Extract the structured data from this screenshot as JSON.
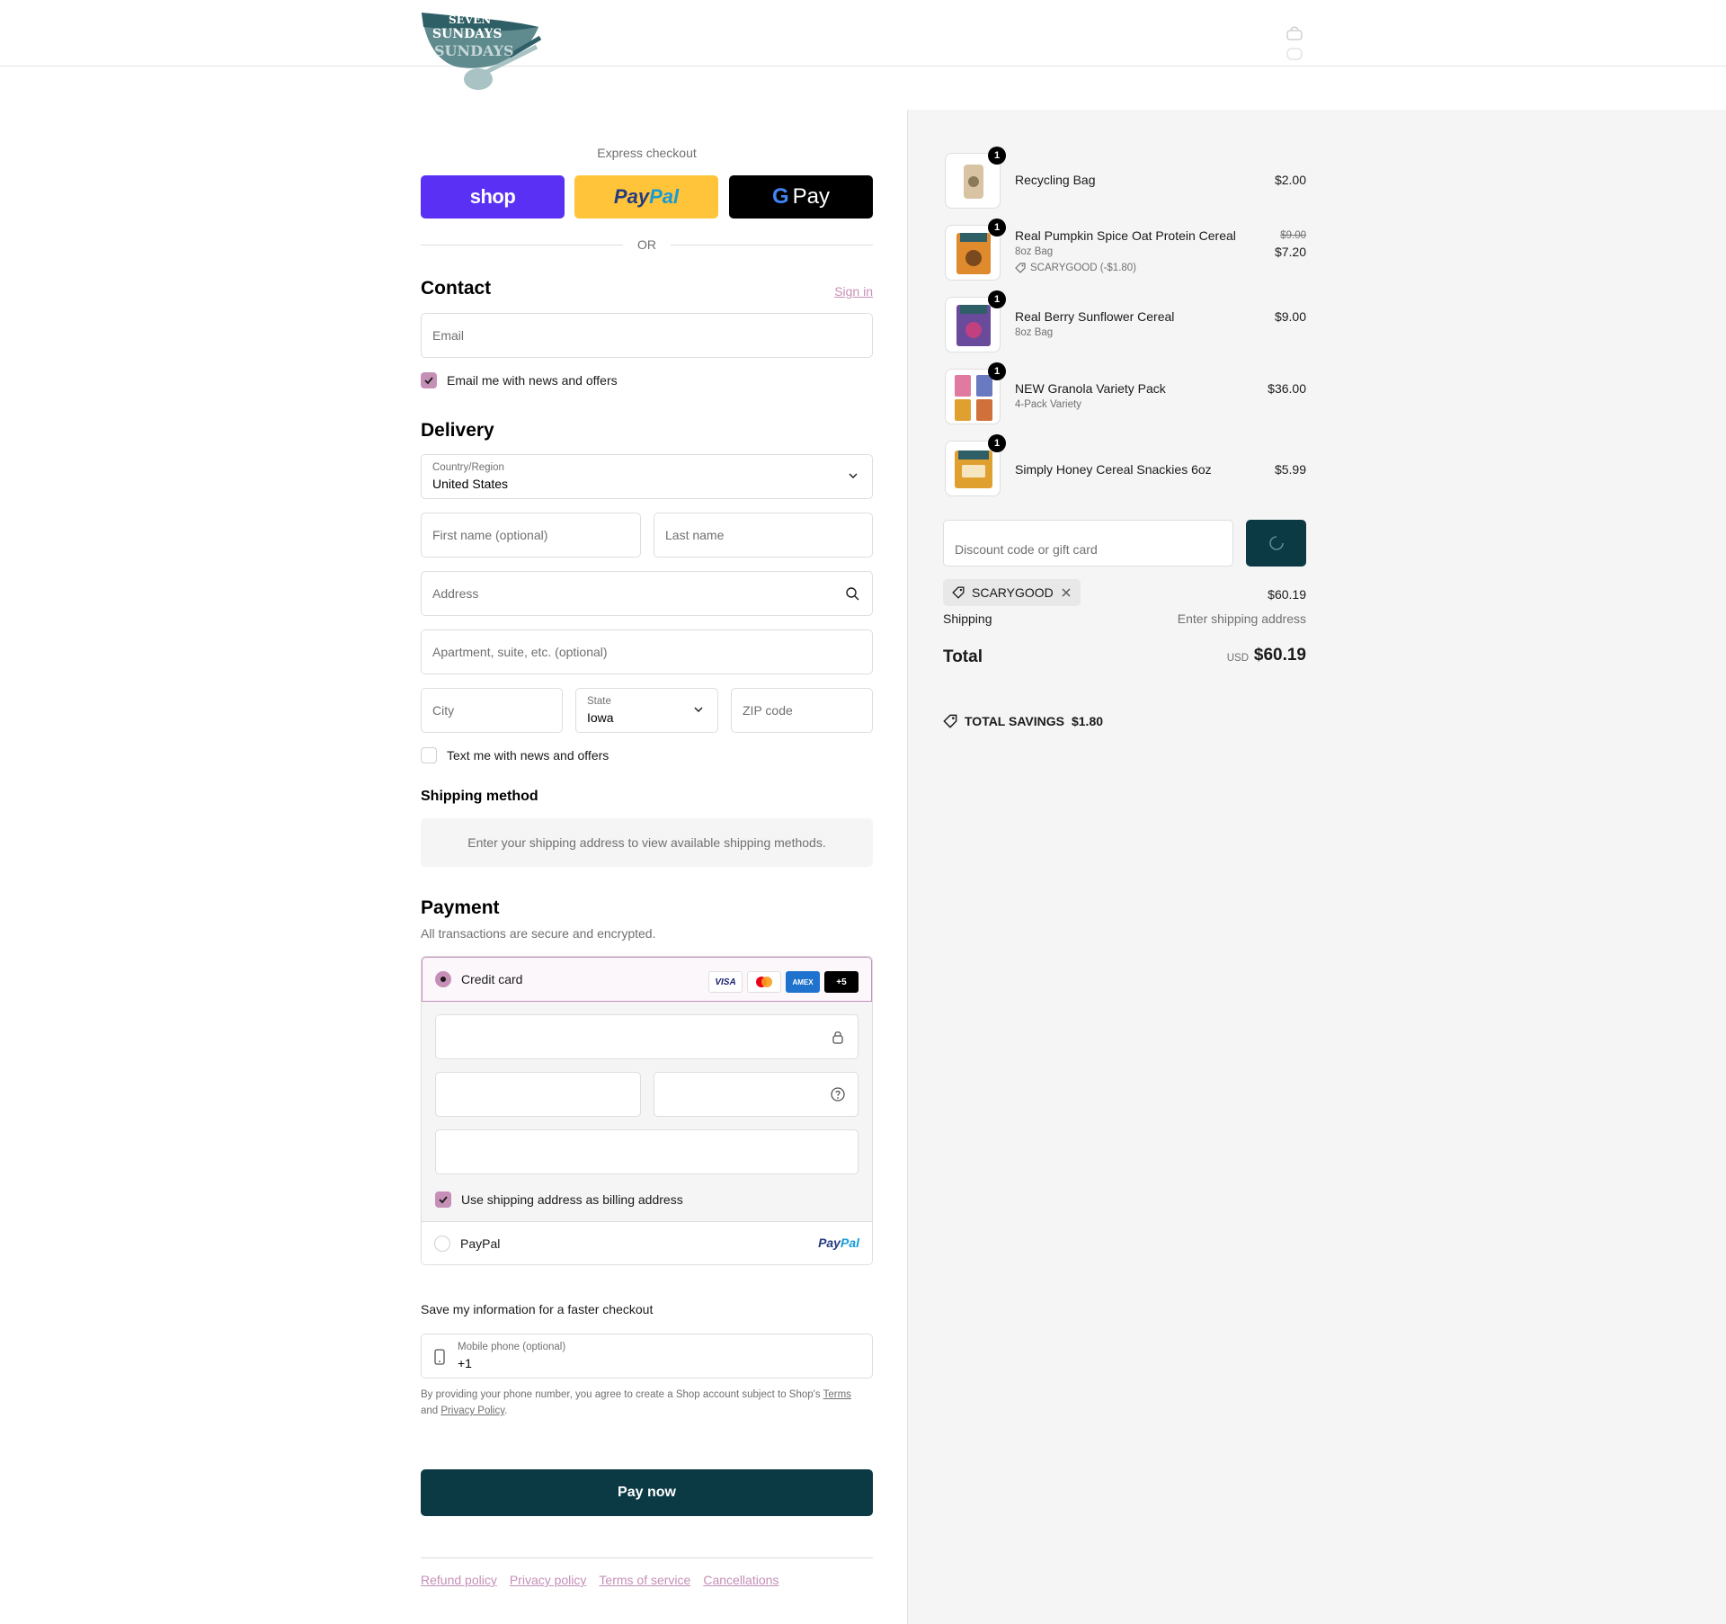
{
  "brand": {
    "logo_text_1": "SEVEN",
    "logo_text_2": "SUNDAYS",
    "logo_alt": "Seven Sundays"
  },
  "express": {
    "title": "Express checkout",
    "shop_label": "shop",
    "paypal_label_1": "Pay",
    "paypal_label_2": "Pal",
    "gpay_g": "G",
    "gpay_label": "Pay",
    "or_label": "OR"
  },
  "contact": {
    "title": "Contact",
    "sign_in": "Sign in",
    "email_placeholder": "Email",
    "email_optin": "Email me with news and offers",
    "email_optin_checked": true
  },
  "delivery": {
    "title": "Delivery",
    "country_label": "Country/Region",
    "country_value": "United States",
    "first_name_placeholder": "First name (optional)",
    "last_name_placeholder": "Last name",
    "address_placeholder": "Address",
    "apartment_placeholder": "Apartment, suite, etc. (optional)",
    "city_placeholder": "City",
    "state_label": "State",
    "state_value": "Iowa",
    "zip_placeholder": "ZIP code",
    "text_optin": "Text me with news and offers",
    "text_optin_checked": false
  },
  "shipping_method": {
    "title": "Shipping method",
    "note": "Enter your shipping address to view available shipping methods."
  },
  "payment": {
    "title": "Payment",
    "subtitle": "All transactions are secure and encrypted.",
    "credit_card_label": "Credit card",
    "card_brands": [
      "VISA",
      "MC",
      "AMEX",
      "+5"
    ],
    "billing_same": "Use shipping address as billing address",
    "billing_same_checked": true,
    "paypal_label": "PayPal",
    "paypal_logo_1": "Pay",
    "paypal_logo_2": "Pal"
  },
  "save_info": {
    "title": "Save my information for a faster checkout",
    "phone_label": "Mobile phone (optional)",
    "phone_value": "+1",
    "note_prefix": "By providing your phone number, you agree to create a Shop account subject to Shop's",
    "terms_link": "Terms",
    "note_and": "and",
    "privacy_link": "Privacy Policy",
    "note_suffix": "."
  },
  "pay_now": "Pay now",
  "footer": {
    "links": [
      "Refund policy",
      "Privacy policy",
      "Terms of service",
      "Cancellations"
    ]
  },
  "summary": {
    "items": [
      {
        "name": "Recycling Bag",
        "variant": "",
        "price": "$2.00",
        "old_price": "",
        "discount": "",
        "qty": "1",
        "thumb_color": "#d8c4a3"
      },
      {
        "name": "Real Pumpkin Spice Oat Protein Cereal",
        "variant": "8oz Bag",
        "price": "$7.20",
        "old_price": "$9.00",
        "discount": "SCARYGOOD (-$1.80)",
        "qty": "1",
        "thumb_color": "#e08a2e"
      },
      {
        "name": "Real Berry Sunflower Cereal",
        "variant": "8oz Bag",
        "price": "$9.00",
        "old_price": "",
        "discount": "",
        "qty": "1",
        "thumb_color": "#6a4a9a"
      },
      {
        "name": "NEW Granola Variety Pack",
        "variant": "4-Pack Variety",
        "price": "$36.00",
        "old_price": "",
        "discount": "",
        "qty": "1",
        "thumb_color": "#e07aa0"
      },
      {
        "name": "Simply Honey Cereal Snackies 6oz",
        "variant": "",
        "price": "$5.99",
        "old_price": "",
        "discount": "",
        "qty": "1",
        "thumb_color": "#e0a030"
      }
    ],
    "discount_placeholder": "Discount code or gift card",
    "applied_code": "SCARYGOOD",
    "subtotal_value": "$60.19",
    "shipping_label": "Shipping",
    "shipping_value": "Enter shipping address",
    "total_label": "Total",
    "total_currency": "USD",
    "total_value": "$60.19",
    "savings_label": "TOTAL SAVINGS",
    "savings_value": "$1.80"
  },
  "colors": {
    "accent_pink": "#c58fb7",
    "primary_teal": "#0c3a44",
    "shop_purple": "#5a31f4",
    "paypal_yellow": "#ffc439"
  }
}
